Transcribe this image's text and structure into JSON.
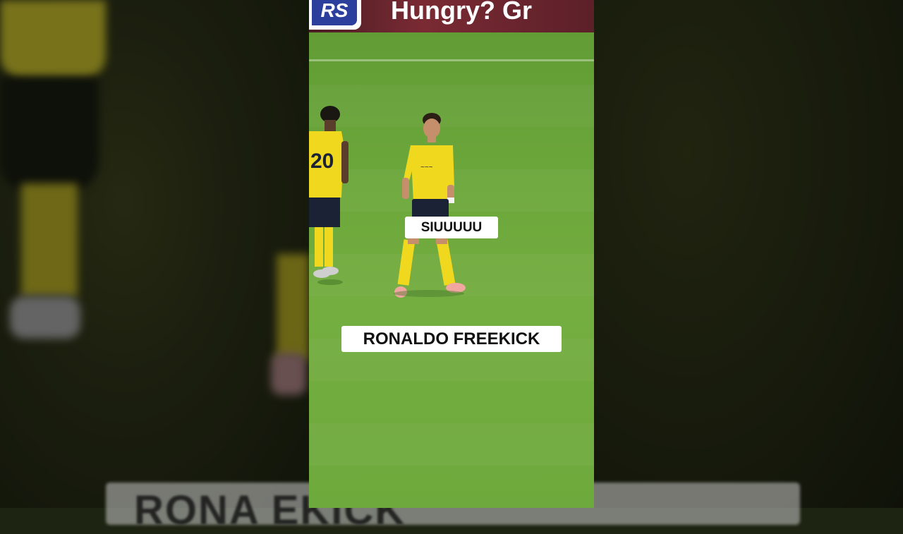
{
  "ad_board": {
    "logo_text": "RS",
    "slogan": "Hungry? Gr"
  },
  "player_left": {
    "shirt_number": "20"
  },
  "captions": {
    "top": "SIUUUUU",
    "bottom": "RONALDO FREEKICK"
  },
  "background_banner": {
    "text": "RONA                  EKICK"
  },
  "colors": {
    "pitch": "#6aa53a",
    "kit_yellow": "#f0d81e",
    "shorts_navy": "#1b2236",
    "caption_bg": "#ffffff",
    "caption_text": "#111111"
  }
}
